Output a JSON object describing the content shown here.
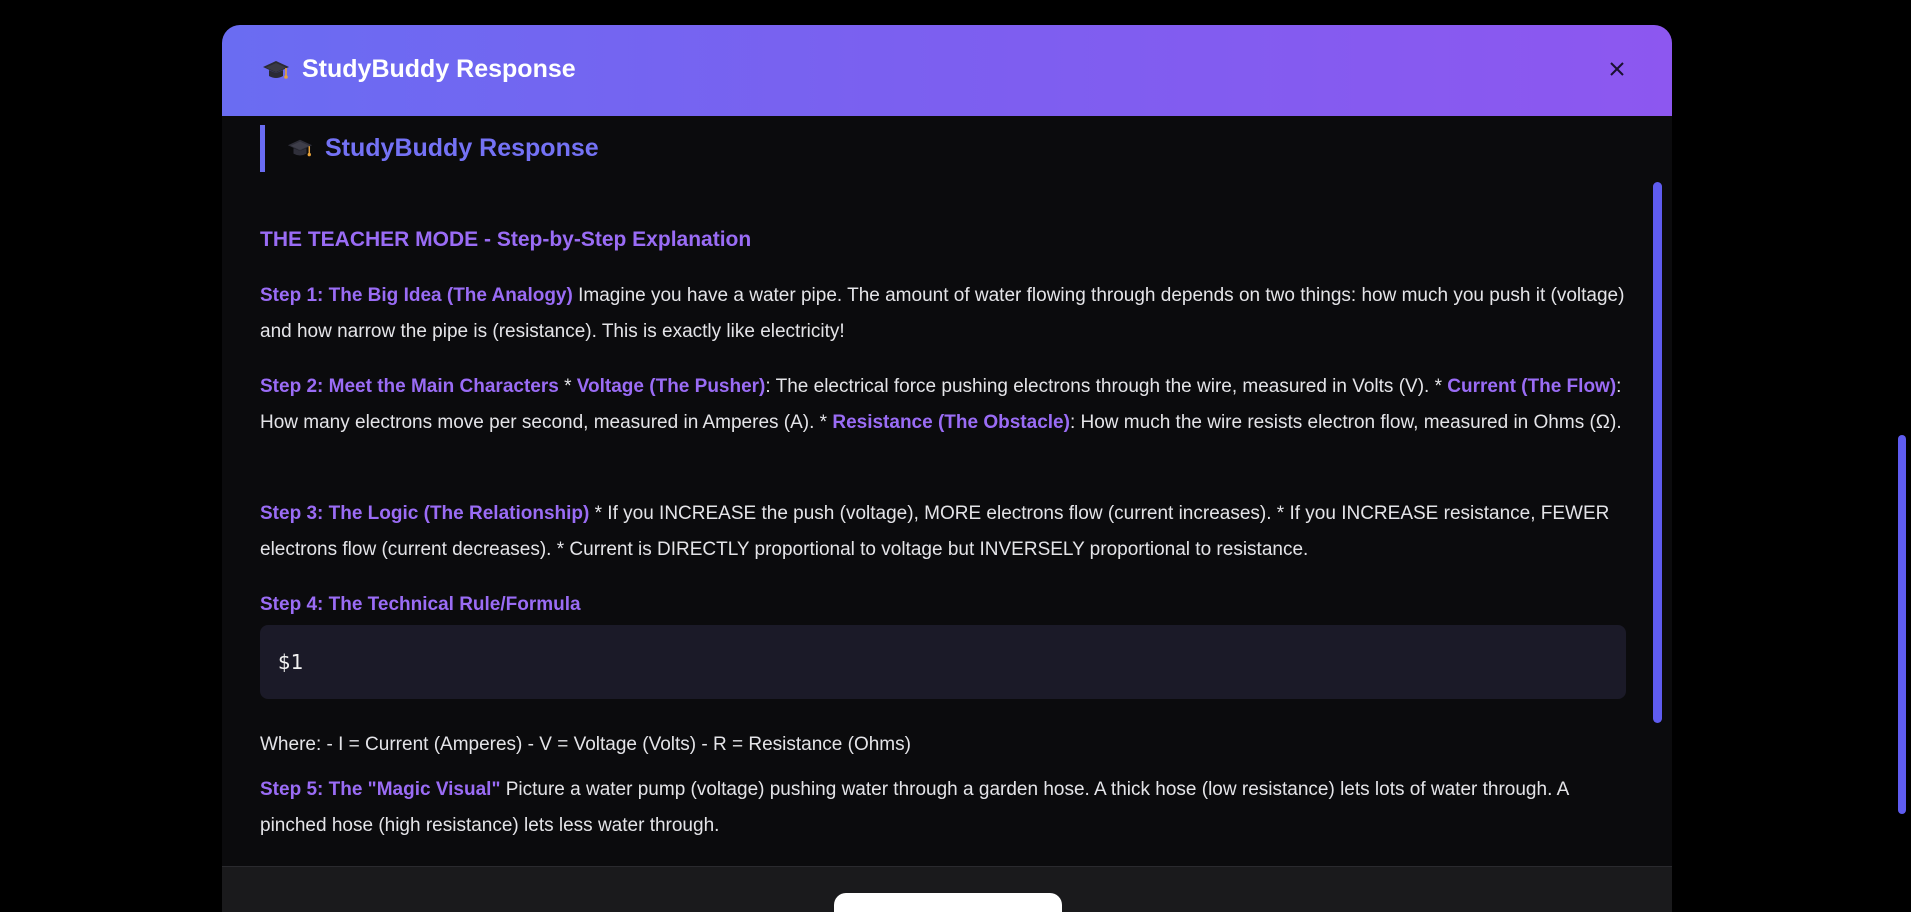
{
  "modal": {
    "header_title": "StudyBuddy Response",
    "close_icon": "close-icon"
  },
  "content": {
    "response_heading": "StudyBuddy Response",
    "mode_title": "THE TEACHER MODE - Step-by-Step Explanation",
    "step1": {
      "label": "Step 1: The Big Idea (The Analogy)",
      "text": " Imagine you have a water pipe. The amount of water flowing through depends on two things: how much you push it (voltage) and how narrow the pipe is (resistance). This is exactly like electricity!"
    },
    "step2": {
      "label": "Step 2: Meet the Main Characters",
      "sep1": " * ",
      "voltage_label": "Voltage (The Pusher)",
      "voltage_text": ": The electrical force pushing electrons through the wire, measured in Volts (V). * ",
      "current_label": "Current (The Flow)",
      "current_text": ": How many electrons move per second, measured in Amperes (A). * ",
      "resistance_label": "Resistance (The Obstacle)",
      "resistance_text": ": How much the wire resists electron flow, measured in Ohms (Ω)."
    },
    "step3": {
      "label": "Step 3: The Logic (The Relationship)",
      "text": " * If you INCREASE the push (voltage), MORE electrons flow (current increases). * If you INCREASE resistance, FEWER electrons flow (current decreases). * Current is DIRECTLY proportional to voltage but INVERSELY proportional to resistance."
    },
    "step4": {
      "label": "Step 4: The Technical Rule/Formula"
    },
    "code_block": "$1",
    "where_text": "Where: - I = Current (Amperes) - V = Voltage (Volts) - R = Resistance (Ohms)",
    "step5": {
      "label": "Step 5: The \"Magic Visual\"",
      "text": " Picture a water pump (voltage) pushing water through a garden hose. A thick hose (low resistance) lets lots of water through. A pinched hose (high resistance) lets less water through."
    }
  },
  "icons": {
    "header": "graduation-cap-icon",
    "heading": "graduation-cap-icon"
  },
  "colors": {
    "header_gradient_start": "#6a6cf2",
    "header_gradient_end": "#8d57f0",
    "accent": "#9a6cf5",
    "heading_accent": "#7472f5",
    "background": "#0b0b0d"
  }
}
